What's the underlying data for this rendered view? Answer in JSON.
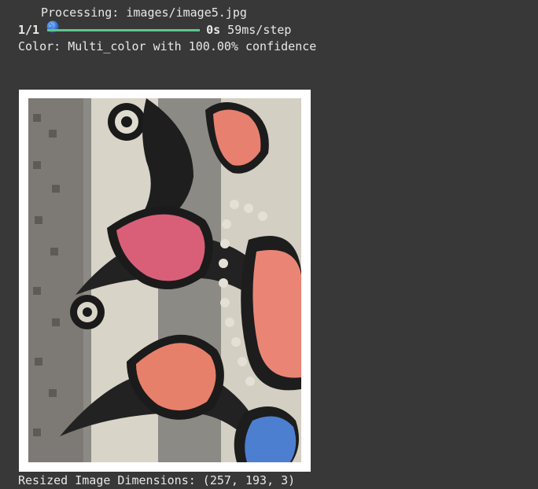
{
  "output": {
    "processing_text": "Processing: images/image5.jpg",
    "progress": {
      "step_count": "1/1",
      "fraction": 1.0,
      "time": "0s",
      "per_step": " 59ms/step"
    },
    "color_result": "Color: Multi_color with 100.00% confidence",
    "dimensions_text": "Resized Image Dimensions: (257, 193, 3)"
  },
  "icons": {
    "processing": "globe-icon"
  },
  "colors": {
    "progress_fill": "#5ec58a",
    "background": "#383838",
    "text": "#e8e8e8"
  }
}
